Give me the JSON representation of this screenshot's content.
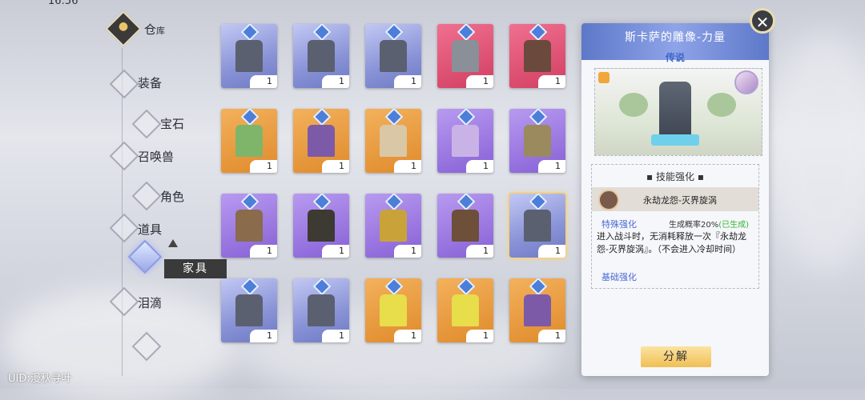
{
  "status": {
    "time": "16:56"
  },
  "nav": {
    "warehouse": {
      "label": "仓",
      "label_small": "库"
    },
    "items": [
      {
        "label": "装备"
      },
      {
        "label": "宝石"
      },
      {
        "label": "召唤兽"
      },
      {
        "label": "角色"
      },
      {
        "label": "道具"
      },
      {
        "label": "家具"
      },
      {
        "label": "泪滴"
      }
    ],
    "selected": "家具"
  },
  "uid": "UID:漫秋寻叶",
  "grid": [
    {
      "color": "blue",
      "art": "statue",
      "count": "1"
    },
    {
      "color": "blue",
      "art": "statue",
      "count": "1"
    },
    {
      "color": "blue",
      "art": "statue",
      "count": "1"
    },
    {
      "color": "red",
      "art": "cabinet",
      "count": "1"
    },
    {
      "color": "red",
      "art": "house",
      "count": "1"
    },
    {
      "color": "orange",
      "art": "flowerbed",
      "count": "1"
    },
    {
      "color": "orange",
      "art": "monster-box",
      "count": "1"
    },
    {
      "color": "orange",
      "art": "lamp",
      "count": "1"
    },
    {
      "color": "purple",
      "art": "vase",
      "count": "1"
    },
    {
      "color": "purple",
      "art": "crystal-rock",
      "count": "1"
    },
    {
      "color": "purple",
      "art": "planter",
      "count": "1"
    },
    {
      "color": "purple",
      "art": "streetlamp",
      "count": "1"
    },
    {
      "color": "purple",
      "art": "tree",
      "count": "1"
    },
    {
      "color": "purple",
      "art": "shop",
      "count": "1"
    },
    {
      "color": "blue",
      "art": "statue",
      "count": "1",
      "selected": true
    },
    {
      "color": "blue",
      "art": "statue",
      "count": "1"
    },
    {
      "color": "blue",
      "art": "statue",
      "count": "1"
    },
    {
      "color": "orange",
      "art": "candle",
      "count": "1"
    },
    {
      "color": "orange",
      "art": "candle",
      "count": "1"
    },
    {
      "color": "orange",
      "art": "monster-box",
      "count": "1"
    }
  ],
  "panel": {
    "title": "斯卡萨的雕像-力量",
    "rarity": "传说",
    "skill_tab": "技能强化",
    "skill_name": "永劫龙怨-灭界旋涡",
    "special_label": "特殊强化",
    "chance_text": "生成概率20%",
    "chance_status": "(已生成)",
    "description": "进入战斗时，无消耗释放一次『永劫龙怨-灭界旋涡』。（不会进入冷却时间）",
    "basic_label": "基础强化",
    "decompose_label": "分解"
  },
  "colors": {
    "blue": "#8892d6",
    "red": "#d23e62",
    "orange": "#e08a2b",
    "purple": "#8660d6",
    "accent": "#3f66c9"
  }
}
